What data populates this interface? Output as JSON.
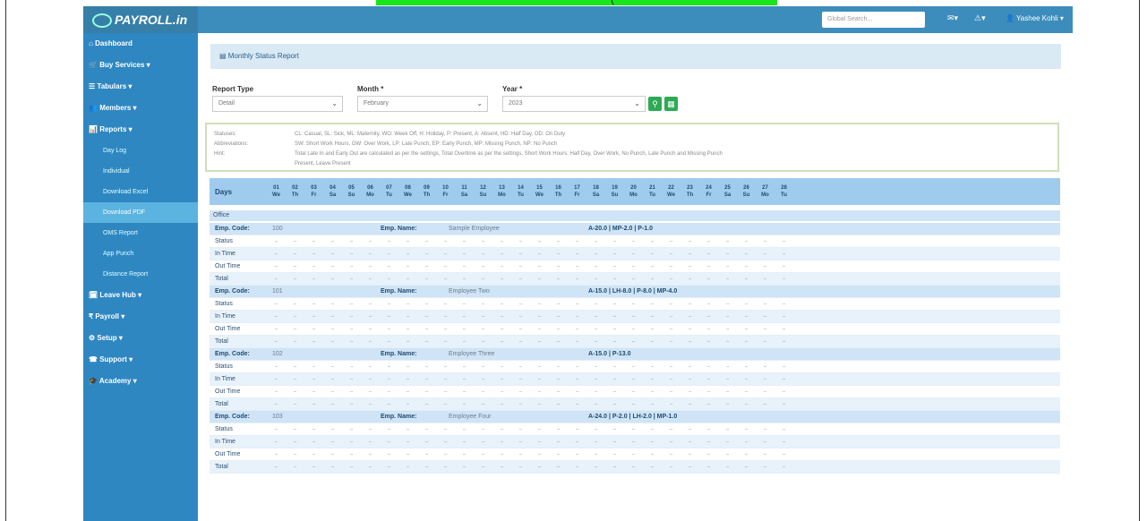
{
  "banner": {
    "text": "("
  },
  "app": {
    "logo": "PAYROLL.in"
  },
  "topbar": {
    "search_placeholder": "Global Search...",
    "mail_icon": "envelope-icon",
    "alert_icon": "bell-icon",
    "user_name": "Yashee Kohli"
  },
  "sidebar": {
    "items": [
      {
        "label": "Dashboard"
      },
      {
        "label": "Buy Services"
      },
      {
        "label": "Tabulars"
      },
      {
        "label": "Members"
      },
      {
        "label": "Reports"
      }
    ],
    "report_sub": [
      {
        "label": "Day Log"
      },
      {
        "label": "Individual"
      },
      {
        "label": "Download Excel"
      },
      {
        "label": "Download PDF"
      },
      {
        "label": "OMS Report"
      },
      {
        "label": "App Punch"
      },
      {
        "label": "Distance Report"
      }
    ],
    "items_after": [
      {
        "label": "Leave Hub"
      },
      {
        "label": "Payroll"
      },
      {
        "label": "Setup"
      },
      {
        "label": "Support"
      },
      {
        "label": "Academy"
      }
    ]
  },
  "breadcrumb": {
    "text": "Monthly Status Report"
  },
  "filters": {
    "report_type_label": "Report Type",
    "report_type_value": "Detail",
    "month_label": "Month *",
    "month_value": "February",
    "year_label": "Year *",
    "year_value": "2023"
  },
  "legend": [
    {
      "k": "Statuses:",
      "v": "CL: Casual, SL: Sick, ML: Maternity, WO: Week Off, H: Holiday, P: Present, A: Absent, HD: Half Day, OD: On Duty"
    },
    {
      "k": "Abbreviations:",
      "v": "SW: Short Work Hours, OW: Over Work, LP: Late Punch, EP: Early Punch, MP: Missing Punch, NP: No Punch"
    },
    {
      "k": "Hint:",
      "v": "Total Late In and Early Out are calculated as per the settings, Total Overtime as per the settings, Short Work Hours: Half Day, Over Work, No Punch, Late Punch and Missing Punch"
    },
    {
      "k": "",
      "v": "Present, Leave Present"
    }
  ],
  "days_header": {
    "label": "Days",
    "days": [
      {
        "n": "01",
        "w": "We"
      },
      {
        "n": "02",
        "w": "Th"
      },
      {
        "n": "03",
        "w": "Fr"
      },
      {
        "n": "04",
        "w": "Sa"
      },
      {
        "n": "05",
        "w": "Su"
      },
      {
        "n": "06",
        "w": "Mo"
      },
      {
        "n": "07",
        "w": "Tu"
      },
      {
        "n": "08",
        "w": "We"
      },
      {
        "n": "09",
        "w": "Th"
      },
      {
        "n": "10",
        "w": "Fr"
      },
      {
        "n": "11",
        "w": "Sa"
      },
      {
        "n": "12",
        "w": "Su"
      },
      {
        "n": "13",
        "w": "Mo"
      },
      {
        "n": "14",
        "w": "Tu"
      },
      {
        "n": "15",
        "w": "We"
      },
      {
        "n": "16",
        "w": "Th"
      },
      {
        "n": "17",
        "w": "Fr"
      },
      {
        "n": "18",
        "w": "Sa"
      },
      {
        "n": "19",
        "w": "Su"
      },
      {
        "n": "20",
        "w": "Mo"
      },
      {
        "n": "21",
        "w": "Tu"
      },
      {
        "n": "22",
        "w": "We"
      },
      {
        "n": "23",
        "w": "Th"
      },
      {
        "n": "24",
        "w": "Fr"
      },
      {
        "n": "25",
        "w": "Sa"
      },
      {
        "n": "26",
        "w": "Su"
      },
      {
        "n": "27",
        "w": "Mo"
      },
      {
        "n": "28",
        "w": "Tu"
      }
    ]
  },
  "section": {
    "label": "Office"
  },
  "employees": [
    {
      "code_label": "Emp. Code:",
      "code": "100",
      "name_label": "Emp. Name:",
      "name": "Sample Employee",
      "summary": "A-20.0 | MP-2.0 | P-1.0"
    },
    {
      "code_label": "Emp. Code:",
      "code": "101",
      "name_label": "Emp. Name:",
      "name": "Employee Two",
      "summary": "A-15.0 | LH-8.0 | P-8.0 | MP-4.0"
    },
    {
      "code_label": "Emp. Code:",
      "code": "102",
      "name_label": "Emp. Name:",
      "name": "Employee Three",
      "summary": "A-15.0 | P-13.0"
    },
    {
      "code_label": "Emp. Code:",
      "code": "103",
      "name_label": "Emp. Name:",
      "name": "Employee Four",
      "summary": "A-24.0 | P-2.0 | LH-2.0 | MP-1.0"
    }
  ],
  "row_labels": [
    "Status",
    "In Time",
    "Out Time",
    "Total"
  ],
  "cell_value": "--"
}
